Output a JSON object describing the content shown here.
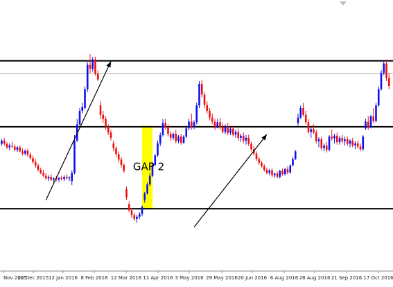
{
  "chart_data": {
    "type": "candlestick",
    "title": "",
    "xlabel": "",
    "ylabel": "",
    "grid": false,
    "y_axis_shown": false,
    "ylim": [
      0,
      1000
    ],
    "x_tick_labels": [
      "Nov 2015",
      "20 Dec 2015",
      "12 Jan 2016",
      "8 Feb 2016",
      "12 Mar 2016",
      "11 Apr 2016",
      "3 May 2016",
      "29 May 2016",
      "20 Jun 2016",
      "6 Aug 2016",
      "28 Aug 2016",
      "21 Sep 2016",
      "17 Oct 2016"
    ],
    "colors": {
      "up": "#1010ee",
      "down": "#ee1010",
      "gap_zone": "#ffff00",
      "level_line": "#000000",
      "gray_line": "#aaaaaa"
    },
    "horizontal_levels": [
      {
        "value": 775,
        "style": "thick"
      },
      {
        "value": 727,
        "style": "thin-gray"
      },
      {
        "value": 531,
        "style": "thick"
      },
      {
        "value": 228,
        "style": "thick"
      }
    ],
    "gap_zone": {
      "start_index": 56,
      "end_index": 60,
      "from": 535,
      "to": 228
    },
    "annotations": [
      {
        "type": "text",
        "text": "GAP 2",
        "index": 58,
        "value": 370
      },
      {
        "type": "arrow",
        "from": {
          "index": 19,
          "value": 260
        },
        "to": {
          "index": 44,
          "value": 773
        }
      },
      {
        "type": "arrow",
        "from": {
          "index": 76,
          "value": 160
        },
        "to": {
          "index": 104,
          "value": 503
        }
      }
    ],
    "candles": [
      {
        "o": 470,
        "h": 480,
        "l": 455,
        "c": 465
      },
      {
        "o": 465,
        "h": 478,
        "l": 452,
        "c": 470
      },
      {
        "o": 468,
        "h": 486,
        "l": 460,
        "c": 480
      },
      {
        "o": 480,
        "h": 490,
        "l": 462,
        "c": 468
      },
      {
        "o": 468,
        "h": 474,
        "l": 448,
        "c": 455
      },
      {
        "o": 455,
        "h": 470,
        "l": 445,
        "c": 462
      },
      {
        "o": 462,
        "h": 475,
        "l": 452,
        "c": 458
      },
      {
        "o": 458,
        "h": 466,
        "l": 440,
        "c": 446
      },
      {
        "o": 446,
        "h": 460,
        "l": 438,
        "c": 455
      },
      {
        "o": 455,
        "h": 462,
        "l": 436,
        "c": 440
      },
      {
        "o": 440,
        "h": 450,
        "l": 425,
        "c": 432
      },
      {
        "o": 432,
        "h": 448,
        "l": 425,
        "c": 442
      },
      {
        "o": 442,
        "h": 450,
        "l": 420,
        "c": 428
      },
      {
        "o": 428,
        "h": 436,
        "l": 410,
        "c": 415
      },
      {
        "o": 415,
        "h": 425,
        "l": 395,
        "c": 400
      },
      {
        "o": 400,
        "h": 412,
        "l": 380,
        "c": 388
      },
      {
        "o": 388,
        "h": 395,
        "l": 366,
        "c": 372
      },
      {
        "o": 372,
        "h": 380,
        "l": 355,
        "c": 360
      },
      {
        "o": 360,
        "h": 372,
        "l": 345,
        "c": 350
      },
      {
        "o": 350,
        "h": 360,
        "l": 335,
        "c": 340
      },
      {
        "o": 340,
        "h": 352,
        "l": 330,
        "c": 346
      },
      {
        "o": 346,
        "h": 356,
        "l": 330,
        "c": 335
      },
      {
        "o": 335,
        "h": 345,
        "l": 325,
        "c": 340
      },
      {
        "o": 340,
        "h": 350,
        "l": 330,
        "c": 336
      },
      {
        "o": 336,
        "h": 346,
        "l": 326,
        "c": 342
      },
      {
        "o": 342,
        "h": 350,
        "l": 332,
        "c": 338
      },
      {
        "o": 338,
        "h": 352,
        "l": 330,
        "c": 346
      },
      {
        "o": 346,
        "h": 356,
        "l": 336,
        "c": 340
      },
      {
        "o": 340,
        "h": 348,
        "l": 330,
        "c": 344
      },
      {
        "o": 330,
        "h": 370,
        "l": 315,
        "c": 360
      },
      {
        "o": 360,
        "h": 500,
        "l": 355,
        "c": 480
      },
      {
        "o": 480,
        "h": 560,
        "l": 475,
        "c": 540
      },
      {
        "o": 540,
        "h": 600,
        "l": 535,
        "c": 590
      },
      {
        "o": 590,
        "h": 620,
        "l": 580,
        "c": 605
      },
      {
        "o": 600,
        "h": 680,
        "l": 595,
        "c": 670
      },
      {
        "o": 670,
        "h": 770,
        "l": 660,
        "c": 760
      },
      {
        "o": 760,
        "h": 800,
        "l": 730,
        "c": 745
      },
      {
        "o": 745,
        "h": 790,
        "l": 735,
        "c": 780
      },
      {
        "o": 780,
        "h": 790,
        "l": 720,
        "c": 728
      },
      {
        "o": 728,
        "h": 740,
        "l": 700,
        "c": 706
      },
      {
        "o": 610,
        "h": 625,
        "l": 560,
        "c": 575
      },
      {
        "o": 575,
        "h": 590,
        "l": 545,
        "c": 560
      },
      {
        "o": 560,
        "h": 570,
        "l": 520,
        "c": 532
      },
      {
        "o": 532,
        "h": 540,
        "l": 500,
        "c": 510
      },
      {
        "o": 510,
        "h": 520,
        "l": 480,
        "c": 490
      },
      {
        "o": 470,
        "h": 480,
        "l": 440,
        "c": 452
      },
      {
        "o": 452,
        "h": 460,
        "l": 420,
        "c": 430
      },
      {
        "o": 430,
        "h": 440,
        "l": 400,
        "c": 410
      },
      {
        "o": 410,
        "h": 418,
        "l": 380,
        "c": 390
      },
      {
        "o": 390,
        "h": 396,
        "l": 360,
        "c": 368
      },
      {
        "o": 300,
        "h": 310,
        "l": 260,
        "c": 270
      },
      {
        "o": 245,
        "h": 255,
        "l": 215,
        "c": 222
      },
      {
        "o": 222,
        "h": 230,
        "l": 195,
        "c": 205
      },
      {
        "o": 205,
        "h": 212,
        "l": 182,
        "c": 190
      },
      {
        "o": 190,
        "h": 205,
        "l": 176,
        "c": 198
      },
      {
        "o": 198,
        "h": 215,
        "l": 190,
        "c": 208
      },
      {
        "o": 208,
        "h": 240,
        "l": 200,
        "c": 235
      },
      {
        "o": 260,
        "h": 290,
        "l": 250,
        "c": 285
      },
      {
        "o": 285,
        "h": 325,
        "l": 280,
        "c": 318
      },
      {
        "o": 318,
        "h": 360,
        "l": 312,
        "c": 350
      },
      {
        "o": 350,
        "h": 400,
        "l": 345,
        "c": 390
      },
      {
        "o": 390,
        "h": 430,
        "l": 385,
        "c": 425
      },
      {
        "o": 425,
        "h": 480,
        "l": 420,
        "c": 470
      },
      {
        "o": 470,
        "h": 510,
        "l": 460,
        "c": 500
      },
      {
        "o": 500,
        "h": 560,
        "l": 495,
        "c": 545
      },
      {
        "o": 545,
        "h": 560,
        "l": 520,
        "c": 528
      },
      {
        "o": 528,
        "h": 540,
        "l": 495,
        "c": 505
      },
      {
        "o": 505,
        "h": 515,
        "l": 480,
        "c": 490
      },
      {
        "o": 490,
        "h": 510,
        "l": 482,
        "c": 505
      },
      {
        "o": 505,
        "h": 520,
        "l": 470,
        "c": 478
      },
      {
        "o": 478,
        "h": 500,
        "l": 470,
        "c": 495
      },
      {
        "o": 495,
        "h": 505,
        "l": 465,
        "c": 472
      },
      {
        "o": 472,
        "h": 500,
        "l": 468,
        "c": 495
      },
      {
        "o": 495,
        "h": 530,
        "l": 490,
        "c": 525
      },
      {
        "o": 525,
        "h": 560,
        "l": 518,
        "c": 550
      },
      {
        "o": 550,
        "h": 580,
        "l": 520,
        "c": 530
      },
      {
        "o": 530,
        "h": 555,
        "l": 522,
        "c": 548
      },
      {
        "o": 548,
        "h": 620,
        "l": 540,
        "c": 610
      },
      {
        "o": 610,
        "h": 700,
        "l": 600,
        "c": 690
      },
      {
        "o": 690,
        "h": 705,
        "l": 640,
        "c": 650
      },
      {
        "o": 650,
        "h": 660,
        "l": 600,
        "c": 612
      },
      {
        "o": 612,
        "h": 625,
        "l": 580,
        "c": 590
      },
      {
        "o": 590,
        "h": 600,
        "l": 555,
        "c": 565
      },
      {
        "o": 565,
        "h": 580,
        "l": 540,
        "c": 550
      },
      {
        "o": 550,
        "h": 560,
        "l": 520,
        "c": 532
      },
      {
        "o": 532,
        "h": 560,
        "l": 525,
        "c": 548
      },
      {
        "o": 548,
        "h": 565,
        "l": 520,
        "c": 530
      },
      {
        "o": 530,
        "h": 545,
        "l": 505,
        "c": 512
      },
      {
        "o": 512,
        "h": 540,
        "l": 505,
        "c": 532
      },
      {
        "o": 532,
        "h": 545,
        "l": 500,
        "c": 508
      },
      {
        "o": 508,
        "h": 530,
        "l": 500,
        "c": 524
      },
      {
        "o": 524,
        "h": 535,
        "l": 495,
        "c": 502
      },
      {
        "o": 502,
        "h": 520,
        "l": 490,
        "c": 512
      },
      {
        "o": 512,
        "h": 525,
        "l": 480,
        "c": 490
      },
      {
        "o": 490,
        "h": 505,
        "l": 475,
        "c": 498
      },
      {
        "o": 498,
        "h": 510,
        "l": 470,
        "c": 480
      },
      {
        "o": 480,
        "h": 500,
        "l": 465,
        "c": 490
      },
      {
        "o": 490,
        "h": 502,
        "l": 460,
        "c": 468
      },
      {
        "o": 468,
        "h": 475,
        "l": 440,
        "c": 448
      },
      {
        "o": 448,
        "h": 460,
        "l": 425,
        "c": 432
      },
      {
        "o": 432,
        "h": 440,
        "l": 405,
        "c": 412
      },
      {
        "o": 412,
        "h": 420,
        "l": 390,
        "c": 398
      },
      {
        "o": 398,
        "h": 405,
        "l": 380,
        "c": 386
      },
      {
        "o": 386,
        "h": 392,
        "l": 365,
        "c": 372
      },
      {
        "o": 372,
        "h": 380,
        "l": 355,
        "c": 360
      },
      {
        "o": 360,
        "h": 375,
        "l": 352,
        "c": 370
      },
      {
        "o": 370,
        "h": 378,
        "l": 345,
        "c": 352
      },
      {
        "o": 352,
        "h": 362,
        "l": 342,
        "c": 358
      },
      {
        "o": 358,
        "h": 366,
        "l": 340,
        "c": 346
      },
      {
        "o": 346,
        "h": 372,
        "l": 340,
        "c": 368
      },
      {
        "o": 368,
        "h": 376,
        "l": 350,
        "c": 356
      },
      {
        "o": 356,
        "h": 380,
        "l": 350,
        "c": 374
      },
      {
        "o": 374,
        "h": 385,
        "l": 355,
        "c": 362
      },
      {
        "o": 362,
        "h": 392,
        "l": 358,
        "c": 388
      },
      {
        "o": 388,
        "h": 420,
        "l": 385,
        "c": 412
      },
      {
        "o": 412,
        "h": 445,
        "l": 408,
        "c": 440
      },
      {
        "o": 545,
        "h": 580,
        "l": 535,
        "c": 565
      },
      {
        "o": 565,
        "h": 610,
        "l": 560,
        "c": 600
      },
      {
        "o": 600,
        "h": 620,
        "l": 570,
        "c": 575
      },
      {
        "o": 575,
        "h": 590,
        "l": 540,
        "c": 548
      },
      {
        "o": 548,
        "h": 560,
        "l": 505,
        "c": 512
      },
      {
        "o": 512,
        "h": 530,
        "l": 490,
        "c": 522
      },
      {
        "o": 522,
        "h": 540,
        "l": 505,
        "c": 510
      },
      {
        "o": 510,
        "h": 520,
        "l": 470,
        "c": 478
      },
      {
        "o": 478,
        "h": 492,
        "l": 455,
        "c": 485
      },
      {
        "o": 485,
        "h": 495,
        "l": 445,
        "c": 452
      },
      {
        "o": 452,
        "h": 470,
        "l": 440,
        "c": 462
      },
      {
        "o": 462,
        "h": 475,
        "l": 435,
        "c": 446
      },
      {
        "o": 446,
        "h": 500,
        "l": 440,
        "c": 495
      },
      {
        "o": 495,
        "h": 520,
        "l": 480,
        "c": 488
      },
      {
        "o": 488,
        "h": 505,
        "l": 470,
        "c": 498
      },
      {
        "o": 498,
        "h": 510,
        "l": 465,
        "c": 474
      },
      {
        "o": 474,
        "h": 498,
        "l": 465,
        "c": 490
      },
      {
        "o": 490,
        "h": 500,
        "l": 470,
        "c": 478
      },
      {
        "o": 478,
        "h": 495,
        "l": 462,
        "c": 485
      },
      {
        "o": 485,
        "h": 495,
        "l": 460,
        "c": 468
      },
      {
        "o": 468,
        "h": 485,
        "l": 455,
        "c": 480
      },
      {
        "o": 480,
        "h": 490,
        "l": 455,
        "c": 462
      },
      {
        "o": 462,
        "h": 478,
        "l": 448,
        "c": 470
      },
      {
        "o": 470,
        "h": 480,
        "l": 450,
        "c": 458
      },
      {
        "o": 458,
        "h": 470,
        "l": 440,
        "c": 448
      },
      {
        "o": 448,
        "h": 500,
        "l": 442,
        "c": 495
      },
      {
        "o": 525,
        "h": 560,
        "l": 520,
        "c": 550
      },
      {
        "o": 550,
        "h": 570,
        "l": 520,
        "c": 530
      },
      {
        "o": 530,
        "h": 575,
        "l": 525,
        "c": 570
      },
      {
        "o": 570,
        "h": 600,
        "l": 545,
        "c": 552
      },
      {
        "o": 552,
        "h": 620,
        "l": 548,
        "c": 610
      },
      {
        "o": 610,
        "h": 680,
        "l": 605,
        "c": 670
      },
      {
        "o": 670,
        "h": 740,
        "l": 665,
        "c": 730
      },
      {
        "o": 730,
        "h": 775,
        "l": 722,
        "c": 765
      },
      {
        "o": 765,
        "h": 780,
        "l": 700,
        "c": 712
      },
      {
        "o": 712,
        "h": 730,
        "l": 670,
        "c": 682
      }
    ]
  }
}
